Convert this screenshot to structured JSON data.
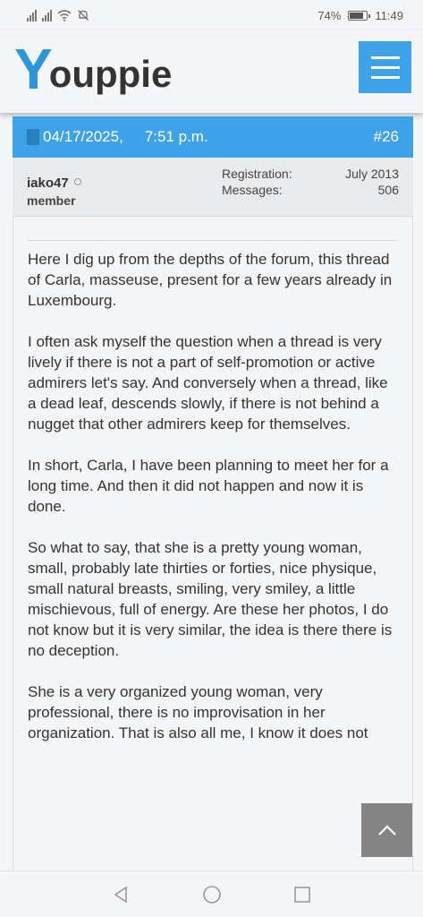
{
  "status_bar": {
    "battery": "74%",
    "time": "11:49",
    "battery_level": 0.74
  },
  "header": {
    "logo_y": "Y",
    "logo_rest": "ouppie",
    "menu_icon": "hamburger-icon",
    "accent": "#3da2e8"
  },
  "post": {
    "date": "04/17/2025,",
    "time": "7:51 p.m.",
    "number": "#26",
    "user": {
      "name": "iako47",
      "role": "member"
    },
    "stats": [
      {
        "label": "Registration:",
        "value": "July 2013"
      },
      {
        "label": "Messages:",
        "value": "506"
      }
    ],
    "paragraphs": [
      "Here I dig up from the depths of the forum, this thread of Carla, masseuse, present for a few years already in Luxembourg.",
      "I often ask myself the question when a thread is very lively if there is not a part of self-promotion or active admirers let's say. And conversely when a thread, like a dead leaf, descends slowly, if there is not behind a nugget that other admirers keep for themselves.",
      "In short, Carla, I have been planning to meet her for a long time. And then it did not happen and now it is done.",
      "So what to say, that she is a pretty young woman, small, probably late thirties or forties, nice physique, small natural breasts, smiling, very smiley, a little mischievous, full of energy. Are these her photos, I do not know but it is very similar, the idea is there there is no deception.",
      "She is a very organized young woman, very professional, there is no improvisation in her organization. That is also all me, I know it does not"
    ]
  }
}
